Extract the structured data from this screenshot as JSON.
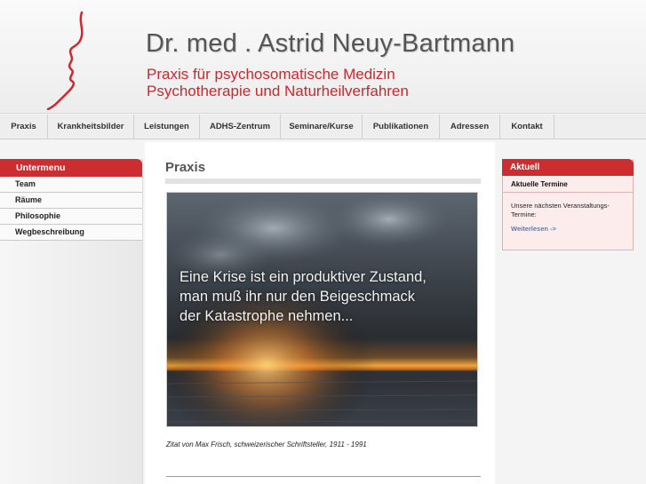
{
  "header": {
    "title": "Dr. med . Astrid Neuy-Bartmann",
    "subtitle1": "Praxis für psychosomatische Medizin",
    "subtitle2": "Psychotherapie und Naturheilverfahren",
    "logo_icon": "face-profile-logo-icon",
    "brand_color": "#d0262c"
  },
  "nav": {
    "items": [
      "Praxis",
      "Krankheitsbilder",
      "Leistungen",
      "ADHS-Zentrum",
      "Seminare/Kurse",
      "Publikationen",
      "Adressen",
      "Kontakt"
    ]
  },
  "sidebar": {
    "heading": "Untermenu",
    "items": [
      "Team",
      "Räume",
      "Philosophie",
      "Wegbeschreibung"
    ]
  },
  "main": {
    "title": "Praxis",
    "hero_text": "Eine Krise ist ein produktiver Zustand,\nman muß ihr nur den Beigeschmack\nder Katastrophe nehmen...",
    "caption": "Zitat von Max Frisch, schweizerischer Schriftsteller, 1911 - 1991"
  },
  "aside": {
    "heading": "Aktuell",
    "subheading": "Aktuelle Termine",
    "text": "Unsere nächsten Veranstaltungs-Termine:",
    "link": "Weiterlesen ->"
  }
}
